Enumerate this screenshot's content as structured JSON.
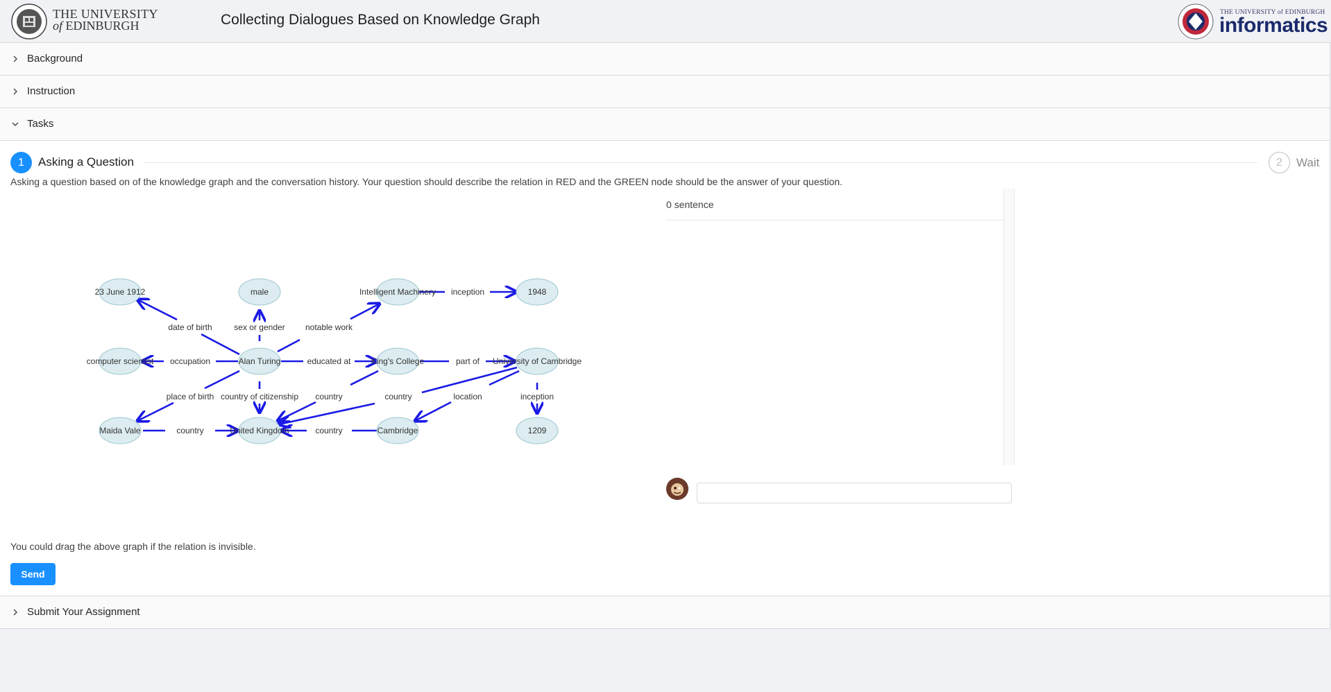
{
  "header": {
    "uoe_line1": "THE UNIVERSITY",
    "uoe_of": "of",
    "uoe_line2": "EDINBURGH",
    "title": "Collecting Dialogues Based on Knowledge Graph",
    "inf_small": "THE UNIVERSITY of EDINBURGH",
    "inf_big": "informatics"
  },
  "panels": {
    "background": "Background",
    "instruction": "Instruction",
    "tasks": "Tasks",
    "submit": "Submit Your Assignment"
  },
  "steps": {
    "step1_num": "1",
    "step1_title": "Asking a Question",
    "step2_num": "2",
    "step2_title": "Wait"
  },
  "instruction_text": "Asking a question based on of the knowledge graph and the conversation history. Your question should describe the relation in RED and the GREEN node should be the answer of your question.",
  "graph": {
    "nodes": {
      "n_dob": "23 June 1912",
      "n_male": "male",
      "n_im": "Intelligent Machinery",
      "n_1948": "1948",
      "n_cs": "computer scientist",
      "n_turing": "Alan Turing",
      "n_kings": "King's College",
      "n_uc": "University of Cambridge",
      "n_maida": "Maida Vale",
      "n_uk": "United Kingdom",
      "n_cam": "Cambridge",
      "n_1209": "1209"
    },
    "edges": {
      "e_dob": "date of birth",
      "e_sex": "sex or gender",
      "e_work": "notable work",
      "e_incep1": "inception",
      "e_occ": "occupation",
      "e_edu": "educated at",
      "e_partof": "part of",
      "e_pob": "place of birth",
      "e_coc": "country of citizenship",
      "e_country1": "country",
      "e_country2": "country",
      "e_loc": "location",
      "e_incep2": "inception",
      "e_country3": "country",
      "e_country4": "country"
    }
  },
  "chat": {
    "count": "0 sentence",
    "input_value": "",
    "input_placeholder": ""
  },
  "hint": "You could drag the above graph if the relation is invisible.",
  "send_label": "Send",
  "colors": {
    "accent": "#1890ff",
    "edge": "#1a1ae6",
    "node_fill": "#dcecf0",
    "node_stroke": "#9cc7d1"
  }
}
